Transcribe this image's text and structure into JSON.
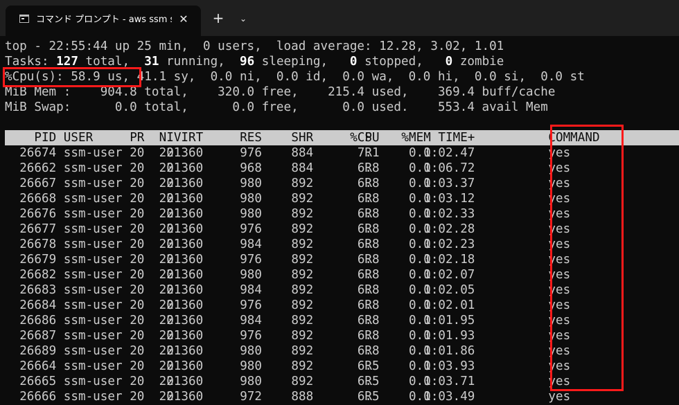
{
  "tab": {
    "title": "コマンド プロンプト - aws  ssm star",
    "close_glyph": "✕",
    "new_tab_glyph": "+",
    "dropdown_glyph": "⌄"
  },
  "summary": {
    "line1": "top - 22:55:44 up 25 min,  0 users,  load average: 12.28, 3.02, 1.01",
    "tasks_label": "Tasks:",
    "tasks_total": "127",
    "tasks_total_label": "total,",
    "tasks_running": "31",
    "tasks_running_label": "running,",
    "tasks_sleeping": "96",
    "tasks_sleeping_label": "sleeping,",
    "tasks_stopped": "0",
    "tasks_stopped_label": "stopped,",
    "tasks_zombie": "0",
    "tasks_zombie_label": "zombie",
    "cpu_line": "%Cpu(s): 58.9 us, 41.1 sy,  0.0 ni,  0.0 id,  0.0 wa,  0.0 hi,  0.0 si,  0.0 st",
    "mem_line": "MiB Mem :    904.8 total,    320.0 free,    215.4 used,    369.4 buff/cache",
    "swap_line": "MiB Swap:      0.0 total,      0.0 free,      0.0 used.    553.4 avail Mem"
  },
  "table": {
    "headers": [
      "PID",
      "USER",
      "PR",
      "NI",
      "VIRT",
      "RES",
      "SHR",
      "S",
      "%CPU",
      "%MEM",
      "TIME+",
      "COMMAND"
    ],
    "rows": [
      [
        "26674",
        "ssm-user",
        "20",
        "0",
        "221360",
        "976",
        "884",
        "R",
        "7.1",
        "0.1",
        "0:02.47",
        "yes"
      ],
      [
        "26662",
        "ssm-user",
        "20",
        "0",
        "221360",
        "968",
        "884",
        "R",
        "6.8",
        "0.1",
        "0:06.72",
        "yes"
      ],
      [
        "26667",
        "ssm-user",
        "20",
        "0",
        "221360",
        "980",
        "892",
        "R",
        "6.8",
        "0.1",
        "0:03.37",
        "yes"
      ],
      [
        "26668",
        "ssm-user",
        "20",
        "0",
        "221360",
        "980",
        "892",
        "R",
        "6.8",
        "0.1",
        "0:03.12",
        "yes"
      ],
      [
        "26676",
        "ssm-user",
        "20",
        "0",
        "221360",
        "980",
        "892",
        "R",
        "6.8",
        "0.1",
        "0:02.33",
        "yes"
      ],
      [
        "26677",
        "ssm-user",
        "20",
        "0",
        "221360",
        "976",
        "892",
        "R",
        "6.8",
        "0.1",
        "0:02.28",
        "yes"
      ],
      [
        "26678",
        "ssm-user",
        "20",
        "0",
        "221360",
        "984",
        "892",
        "R",
        "6.8",
        "0.1",
        "0:02.23",
        "yes"
      ],
      [
        "26679",
        "ssm-user",
        "20",
        "0",
        "221360",
        "976",
        "892",
        "R",
        "6.8",
        "0.1",
        "0:02.18",
        "yes"
      ],
      [
        "26682",
        "ssm-user",
        "20",
        "0",
        "221360",
        "980",
        "892",
        "R",
        "6.8",
        "0.1",
        "0:02.07",
        "yes"
      ],
      [
        "26683",
        "ssm-user",
        "20",
        "0",
        "221360",
        "984",
        "892",
        "R",
        "6.8",
        "0.1",
        "0:02.05",
        "yes"
      ],
      [
        "26684",
        "ssm-user",
        "20",
        "0",
        "221360",
        "976",
        "892",
        "R",
        "6.8",
        "0.1",
        "0:02.01",
        "yes"
      ],
      [
        "26686",
        "ssm-user",
        "20",
        "0",
        "221360",
        "984",
        "892",
        "R",
        "6.8",
        "0.1",
        "0:01.95",
        "yes"
      ],
      [
        "26687",
        "ssm-user",
        "20",
        "0",
        "221360",
        "976",
        "892",
        "R",
        "6.8",
        "0.1",
        "0:01.93",
        "yes"
      ],
      [
        "26689",
        "ssm-user",
        "20",
        "0",
        "221360",
        "980",
        "892",
        "R",
        "6.8",
        "0.1",
        "0:01.86",
        "yes"
      ],
      [
        "26664",
        "ssm-user",
        "20",
        "0",
        "221360",
        "980",
        "892",
        "R",
        "6.5",
        "0.1",
        "0:03.93",
        "yes"
      ],
      [
        "26665",
        "ssm-user",
        "20",
        "0",
        "221360",
        "980",
        "892",
        "R",
        "6.5",
        "0.1",
        "0:03.71",
        "yes"
      ],
      [
        "26666",
        "ssm-user",
        "20",
        "0",
        "221360",
        "972",
        "888",
        "R",
        "6.5",
        "0.1",
        "0:03.49",
        "yes"
      ]
    ]
  },
  "colors": {
    "terminal_bg": "#0c0c0c",
    "text": "#cccccc",
    "header_bg": "#cccccc",
    "highlight": "#ff1a1a"
  }
}
